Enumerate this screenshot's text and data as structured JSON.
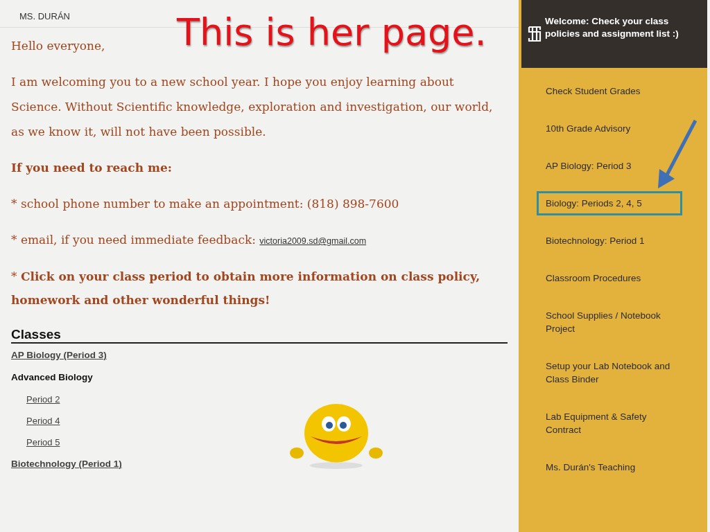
{
  "slide_title": "This is her page.",
  "site_title": "MS. DURÁN",
  "intro": {
    "greeting": "Hello everyone,",
    "paragraph": "I am welcoming you to a new school year.  I hope you enjoy learning about Science.  Without Scientific knowledge, exploration and investigation, our world, as we know it, will not have been possible.",
    "contact_heading": "If you need to reach me:",
    "phone_line": "* school phone number to make an appointment: (818) 898-7600",
    "email_line": {
      "text": "* email, if you need immediate feedback:",
      "link": "victoria2009.sd@gmail.com"
    },
    "click_line": "* **Click on your class period to obtain more information on class policy, homework and other wonderful things!**"
  },
  "classes": {
    "heading": "Classes",
    "items": [
      {
        "kind": "link",
        "label": "AP Biology (Period 3)"
      },
      {
        "kind": "group",
        "label": "Advanced Biology",
        "children": [
          {
            "kind": "link",
            "label": "Period 2"
          },
          {
            "kind": "link",
            "label": "Period 4"
          },
          {
            "kind": "link",
            "label": "Period 5"
          }
        ]
      },
      {
        "kind": "link",
        "label": "Biotechnology (Period 1)"
      }
    ]
  },
  "sidebar": {
    "header": "Welcome: Check your class policies and assignment list :)",
    "items": [
      {
        "label": "Check Student Grades",
        "selected": false
      },
      {
        "label": "10th Grade Advisory",
        "selected": false
      },
      {
        "label": "AP Biology: Period 3",
        "selected": false
      },
      {
        "label": "Biology: Periods 2, 4, 5",
        "selected": true
      },
      {
        "label": "Biotechnology: Period 1",
        "selected": false
      },
      {
        "label": "Classroom Procedures",
        "selected": false
      },
      {
        "label": "School Supplies / Notebook Project",
        "selected": false
      },
      {
        "label": "Setup your Lab Notebook and Class Binder",
        "selected": false
      },
      {
        "label": "Lab Equipment & Safety Contract",
        "selected": false
      },
      {
        "label": "Ms. Durán's Teaching",
        "selected": false
      }
    ]
  }
}
